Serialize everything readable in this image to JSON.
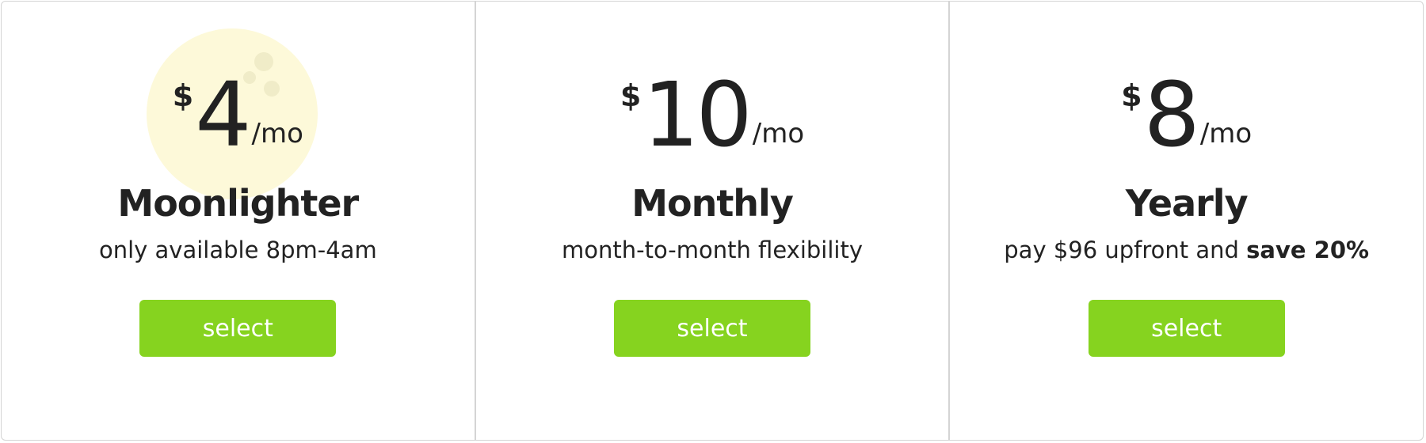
{
  "plans": [
    {
      "currency": "$",
      "amount": "4",
      "period": "/mo",
      "name": "Moonlighter",
      "description": "only available 8pm-4am",
      "button_label": "select"
    },
    {
      "currency": "$",
      "amount": "10",
      "period": "/mo",
      "name": "Monthly",
      "description": "month-to-month flexibility",
      "button_label": "select"
    },
    {
      "currency": "$",
      "amount": "8",
      "period": "/mo",
      "name": "Yearly",
      "description": "pay $96 upfront and ",
      "description_emphasis": "save 20%",
      "button_label": "select"
    }
  ],
  "colors": {
    "button": "#86d31f",
    "moon": "#fdf9d9",
    "border": "#d4d4d4",
    "text": "#222222"
  },
  "icons": {
    "moon": "moon-icon"
  }
}
